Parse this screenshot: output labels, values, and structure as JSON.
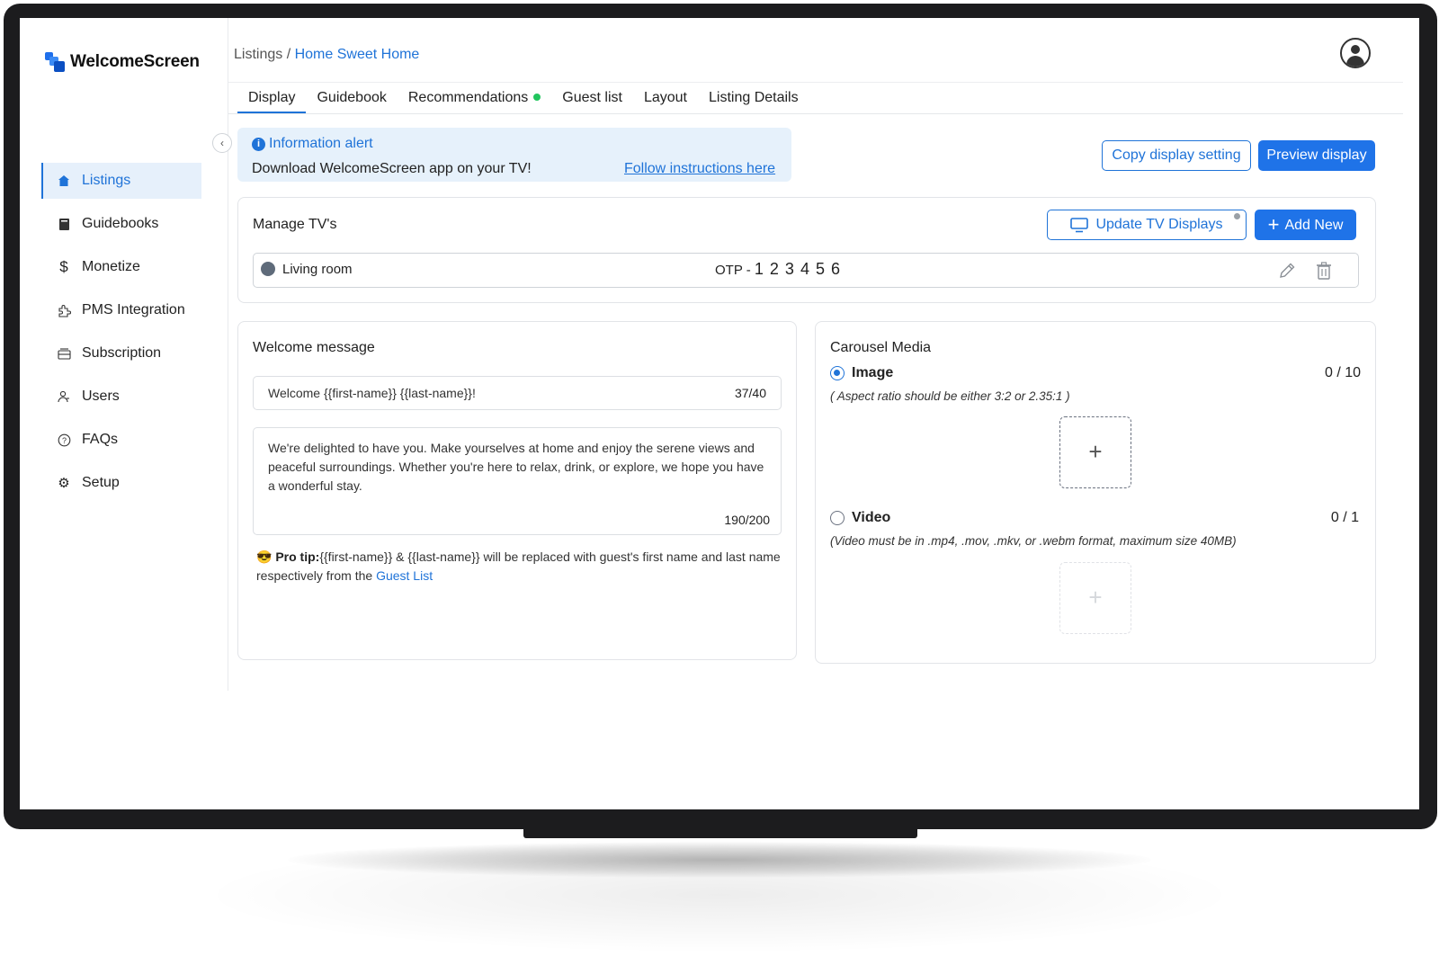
{
  "app": {
    "name": "WelcomeScreen"
  },
  "sidebar": {
    "items": [
      {
        "label": "Listings",
        "icon": "home-icon"
      },
      {
        "label": "Guidebooks",
        "icon": "book-icon"
      },
      {
        "label": "Monetize",
        "icon": "dollar-icon"
      },
      {
        "label": "PMS Integration",
        "icon": "puzzle-icon"
      },
      {
        "label": "Subscription",
        "icon": "subscription-icon"
      },
      {
        "label": "Users",
        "icon": "user-icon"
      },
      {
        "label": "FAQs",
        "icon": "question-icon"
      },
      {
        "label": "Setup",
        "icon": "gear-icon"
      }
    ],
    "collapse_glyph": "‹"
  },
  "breadcrumb": {
    "root": "Listings",
    "separator": " / ",
    "current": "Home Sweet Home"
  },
  "tabs": [
    "Display",
    "Guidebook",
    "Recommendations",
    "Guest list",
    "Layout",
    "Listing Details"
  ],
  "alert": {
    "title": "Information alert",
    "text": "Download WelcomeScreen app on your TV!",
    "link": "Follow instructions here"
  },
  "actions": {
    "copy": "Copy display setting",
    "preview": "Preview display"
  },
  "manage_tvs": {
    "title": "Manage TV's",
    "update_button": "Update TV Displays",
    "add_button": "Add New",
    "tvs": [
      {
        "name": "Living room",
        "otp_label": "OTP - ",
        "otp_code": "1 2 3 4 5 6"
      }
    ]
  },
  "welcome": {
    "title": "Welcome message",
    "headline": "Welcome {{first-name}} {{last-name}}!",
    "headline_count": "37/40",
    "body": "We're delighted to have you. Make yourselves at home and enjoy the serene views and peaceful surroundings. Whether you're here to relax, drink, or explore, we hope you have a wonderful stay.",
    "body_count": "190/200",
    "tip_emoji": "😎",
    "tip_label": "Pro tip:",
    "tip_text": "{{first-name}} & {{last-name}} will be replaced with guest's first name and last name respectively from the ",
    "tip_link": "Guest List"
  },
  "carousel": {
    "title": "Carousel Media",
    "image_label": "Image",
    "image_count": "0 / 10",
    "image_hint": "( Aspect ratio should be either 3:2 or 2.35:1 )",
    "video_label": "Video",
    "video_count": "0 / 1",
    "video_hint": "(Video must be in .mp4, .mov, .mkv, or .webm format, maximum size 40MB)",
    "upload_glyph": "+"
  },
  "colors": {
    "accent": "#1f73d8",
    "status_green": "#22c55e",
    "tv_frame": "#1c1c1e"
  }
}
